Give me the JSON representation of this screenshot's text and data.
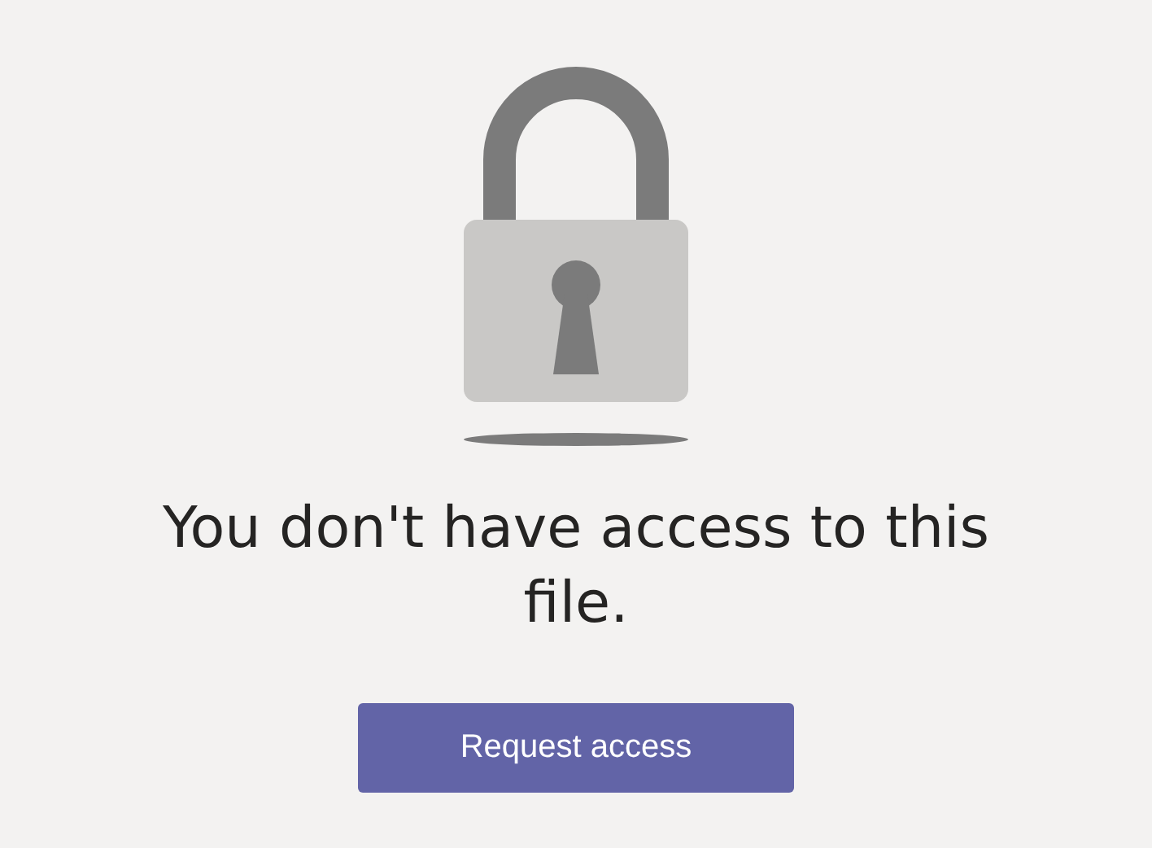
{
  "message": "You don't have access to this file.",
  "button": {
    "label": "Request access"
  }
}
